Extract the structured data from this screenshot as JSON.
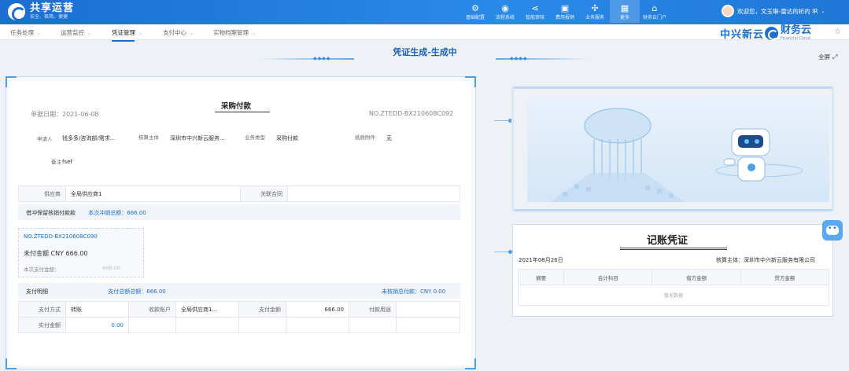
{
  "brand": {
    "name": "共享运营",
    "slogan": "安全、极简、便捷"
  },
  "topnav": [
    {
      "label": "基础配置",
      "icon": "settings-icon"
    },
    {
      "label": "流程系统",
      "icon": "flow-icon"
    },
    {
      "label": "智能审核",
      "icon": "share-icon"
    },
    {
      "label": "费用报销",
      "icon": "wallet-icon"
    },
    {
      "label": "业务服务",
      "icon": "service-icon"
    },
    {
      "label": "更多",
      "icon": "grid-icon"
    },
    {
      "label": "财务云门户",
      "icon": "home-icon"
    }
  ],
  "user": {
    "greeting": "欢迎您，文玉琳-雷达的析的 IR"
  },
  "tabs": [
    "任务处理",
    "运营监控",
    "凭证管理",
    "支付中心",
    "档案中心",
    "实物档案管理"
  ],
  "logos": {
    "zx": "中兴新云",
    "cw": "财务云",
    "cw_sub": "Financial Cloud"
  },
  "banner": {
    "title": "凭证生成-生成中"
  },
  "fullscreen": "全屏",
  "doc": {
    "title": "采购付款",
    "date_label": "单据日期：",
    "date": "2021-06-08",
    "no": "NO.ZTEDD-BX210608C092",
    "fields": {
      "applicant_label": "申请人",
      "applicant": "钱多多/咨询部/需求...",
      "entity_label": "核算主体",
      "entity": "深圳市中兴新云服务...",
      "biz_label": "业务类型",
      "biz": "采购付款",
      "attach_label": "纸质附件",
      "attach": "无",
      "remark_label": "备注",
      "remark": "fsef"
    },
    "supplier_label": "供应商",
    "supplier": "全局供应商1",
    "contract_label": "关联合同",
    "contract": "",
    "offset_label": "借冲保留核销付款款",
    "offset_total_label": "本次冲销总额：",
    "offset_total": "666.00",
    "card_no": "NO.ZTEDD-BX210608C090",
    "card_unpaid": "未付金额 CNY 666.00",
    "card_pay_label": "本次支付金额：",
    "card_pay": "666.00",
    "pay_detail_label": "支付明细",
    "pay_total_label": "支付总额总额：",
    "pay_total": "666.00",
    "unpaid_label": "未核销总付款：",
    "unpaid": "CNY 0.00",
    "pay_row": {
      "method_label": "支付方式",
      "method": "转账",
      "account_label": "收款账户",
      "account": "全局供应商1...",
      "amount_label": "支付金额",
      "amount": "666.00",
      "purpose_label": "付款用途",
      "purpose": ""
    },
    "actual_label": "实付金额",
    "actual": "0.00"
  },
  "voucher": {
    "title": "记账凭证",
    "date": "2021年08月26日",
    "entity": "核算主体：深圳市中兴新云服务有限公司",
    "columns": [
      "摘要",
      "会计科目",
      "借方金额",
      "贷方金额"
    ],
    "empty": "暂无数据"
  },
  "colors": {
    "primary": "#1a6fd0",
    "accent": "#4f9fe8"
  }
}
